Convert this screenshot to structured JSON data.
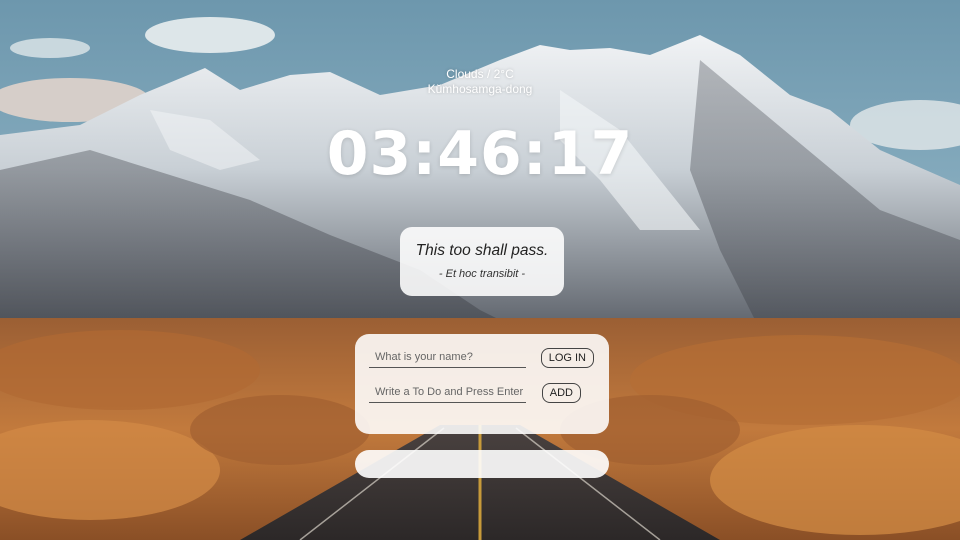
{
  "weather": {
    "condition_temp": "Clouds / 2°C",
    "location": "Kŭmhosamga-dong"
  },
  "clock": {
    "time": "03:46:17"
  },
  "quote": {
    "text": "This too shall pass.",
    "author": "- Et hoc transibit -"
  },
  "login": {
    "name_placeholder": "What is your name?",
    "button_label": "LOG IN"
  },
  "todo": {
    "input_placeholder": "Write a To Do and Press Enter",
    "button_label": "ADD",
    "items": []
  },
  "background": {
    "description_colors": {
      "sky": "#7ea4b8",
      "snow": "#e8ecef",
      "rock": "#4a4e55",
      "brush": "#c7773a"
    }
  }
}
